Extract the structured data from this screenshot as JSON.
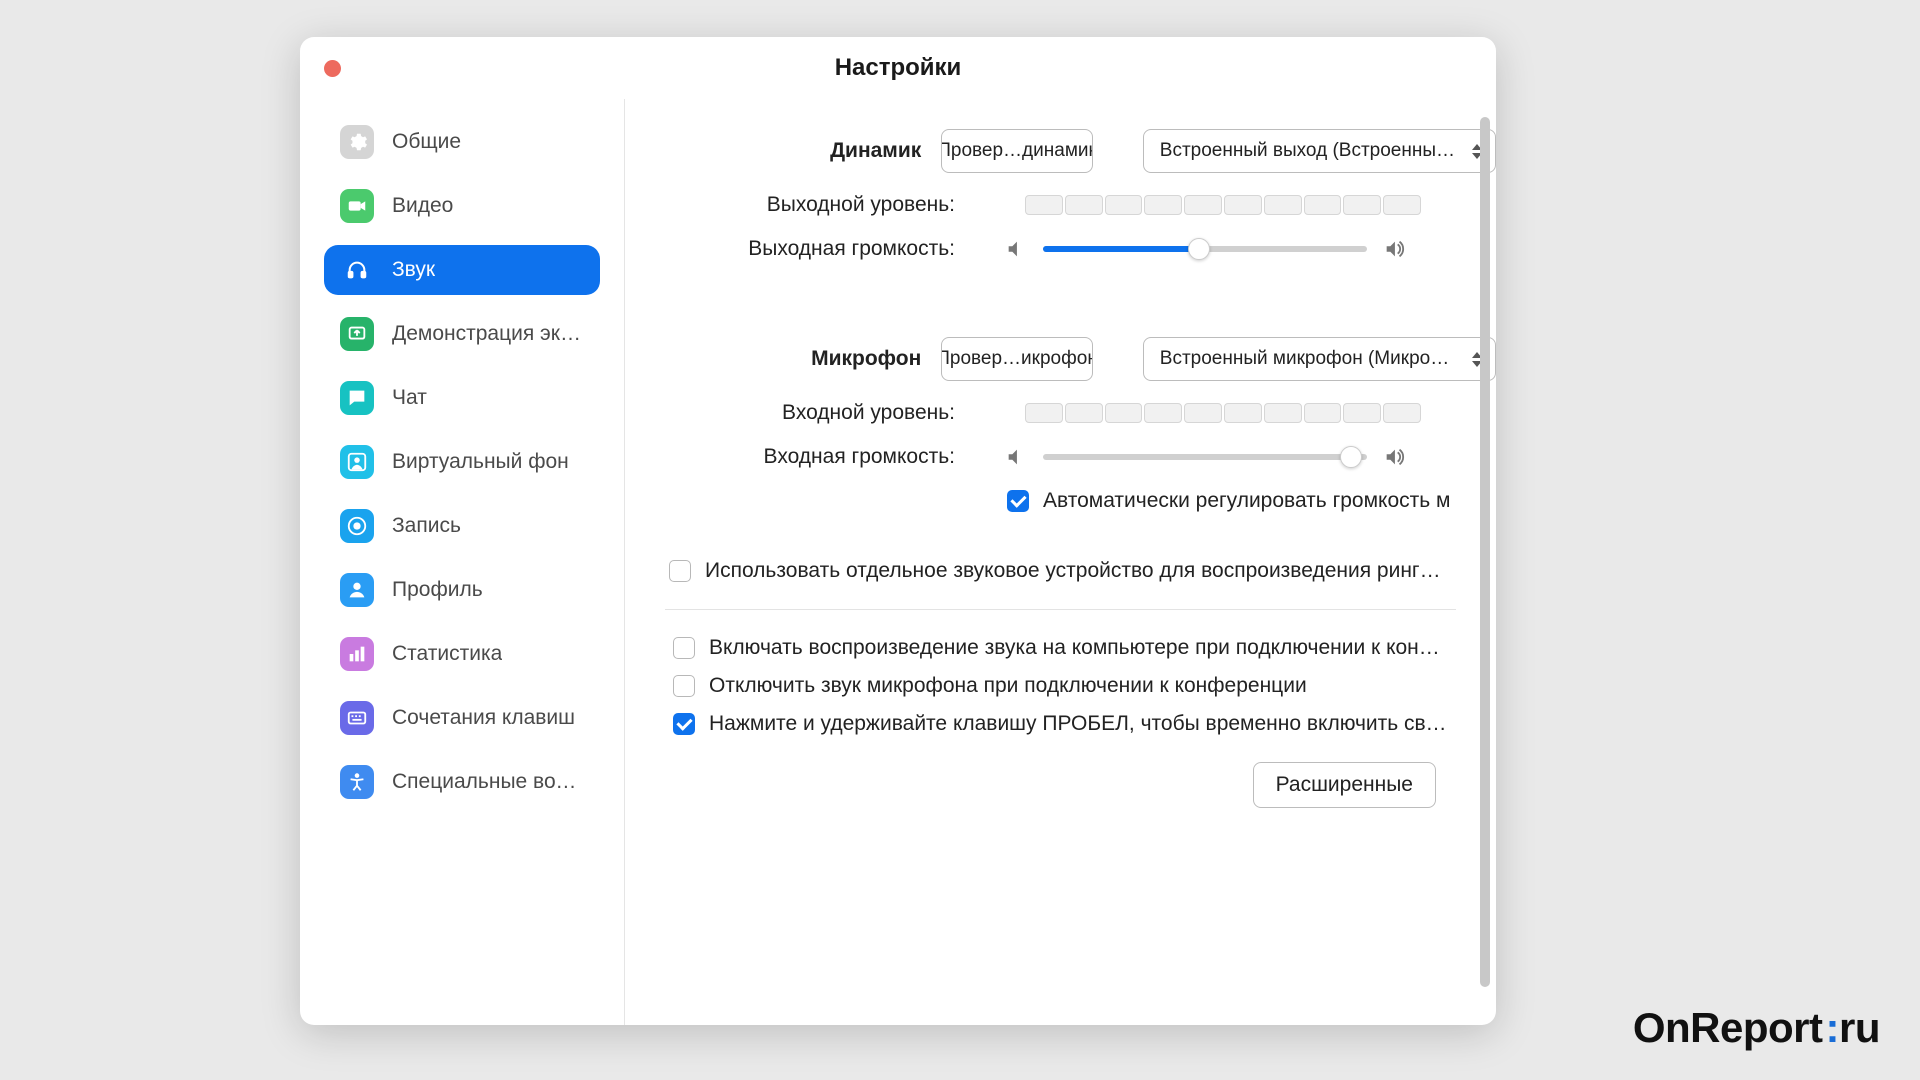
{
  "watermark": {
    "prefix": "OnReport",
    "suffix": "ru"
  },
  "window": {
    "title": "Настройки",
    "close_color": "#ed6a5e"
  },
  "sidebar": {
    "items": [
      {
        "key": "general",
        "label": "Общие",
        "icon": "gear",
        "color": "#d5d5d5",
        "active": false
      },
      {
        "key": "video",
        "label": "Видео",
        "icon": "camera",
        "color": "#4bca6d",
        "active": false
      },
      {
        "key": "audio",
        "label": "Звук",
        "icon": "headphones",
        "color": "#ffffff",
        "active": true
      },
      {
        "key": "share",
        "label": "Демонстрация экр…",
        "icon": "share",
        "color": "#27b36a",
        "active": false
      },
      {
        "key": "chat",
        "label": "Чат",
        "icon": "chat",
        "color": "#17c2c2",
        "active": false
      },
      {
        "key": "vbg",
        "label": "Виртуальный фон",
        "icon": "background",
        "color": "#21c0e8",
        "active": false
      },
      {
        "key": "record",
        "label": "Запись",
        "icon": "record",
        "color": "#1aa3ee",
        "active": false
      },
      {
        "key": "profile",
        "label": "Профиль",
        "icon": "profile",
        "color": "#2a9df4",
        "active": false
      },
      {
        "key": "stats",
        "label": "Статистика",
        "icon": "stats",
        "color": "#c97be0",
        "active": false
      },
      {
        "key": "shortcuts",
        "label": "Сочетания клавиш",
        "icon": "keyboard",
        "color": "#6a6ae8",
        "active": false
      },
      {
        "key": "accessibility",
        "label": "Специальные возм…",
        "icon": "accessibility",
        "color": "#3f8bf0",
        "active": false
      }
    ]
  },
  "content": {
    "speaker": {
      "heading": "Динамик",
      "test_label": "Провер…динамик",
      "device_selected": "Встроенный выход (Встроенные дин…",
      "output_level_label": "Выходной уровень:",
      "output_volume_label": "Выходная громкость:",
      "volume_percent": 48
    },
    "mic": {
      "heading": "Микрофон",
      "test_label": "Провер…икрофон",
      "device_selected": "Встроенный микрофон (Микрофон)",
      "input_level_label": "Входной уровень:",
      "input_volume_label": "Входная громкость:",
      "volume_percent": 95,
      "auto_adjust": {
        "checked": true,
        "label": "Автоматически регулировать громкость м"
      }
    },
    "ringtone_checkbox": {
      "checked": false,
      "label": "Использовать отдельное звуковое устройство для воспроизведения рингтона"
    },
    "join_options": [
      {
        "key": "join_audio",
        "checked": false,
        "label": "Включать воспроизведение звука на компьютере при подключении к конфер…"
      },
      {
        "key": "mute_on_join",
        "checked": false,
        "label": "Отключить звук микрофона при подключении к конференции"
      },
      {
        "key": "spacebar_ptt",
        "checked": true,
        "label": "Нажмите и удерживайте клавишу ПРОБЕЛ, чтобы временно включить свой зв…"
      }
    ],
    "advanced_label": "Расширенные"
  }
}
